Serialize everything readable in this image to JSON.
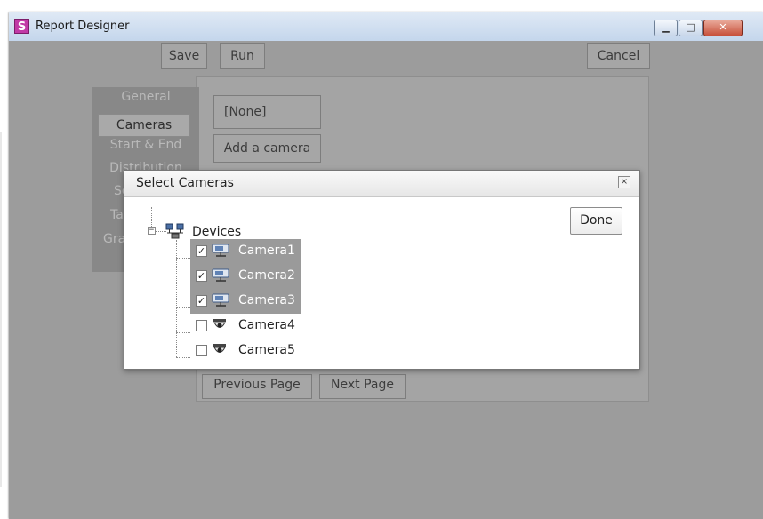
{
  "window": {
    "title": "Report Designer",
    "logo_letter": "S"
  },
  "toolbar": {
    "save_label": "Save",
    "run_label": "Run",
    "cancel_label": "Cancel"
  },
  "nav": {
    "items": [
      "General",
      "Cameras",
      "Start & End",
      "Distribution",
      "Sc",
      "Tab",
      "Gra"
    ],
    "active": "Cameras"
  },
  "cameras_panel": {
    "selected_value": "[None]",
    "add_label": "Add a camera"
  },
  "paging": {
    "previous_label": "Previous Page",
    "next_label": "Next Page"
  },
  "dialog": {
    "title": "Select Cameras",
    "close_symbol": "×",
    "root_label": "Devices",
    "expander_symbol": "−",
    "done_label": "Done",
    "cameras": [
      {
        "label": "Camera1",
        "checked": true,
        "selected": true,
        "icon": "camera-box-icon"
      },
      {
        "label": "Camera2",
        "checked": true,
        "selected": true,
        "icon": "camera-box-icon"
      },
      {
        "label": "Camera3",
        "checked": true,
        "selected": true,
        "icon": "camera-box-icon"
      },
      {
        "label": "Camera4",
        "checked": false,
        "selected": false,
        "icon": "dome-camera-icon"
      },
      {
        "label": "Camera5",
        "checked": false,
        "selected": false,
        "icon": "dome-camera-icon"
      }
    ],
    "check_symbol": "✓"
  },
  "colors": {
    "overlay_gray": "#9c9c9c",
    "selection_gray": "#9a9a9a",
    "close_red": "#c7503a",
    "logo_magenta": "#c13aa6"
  }
}
